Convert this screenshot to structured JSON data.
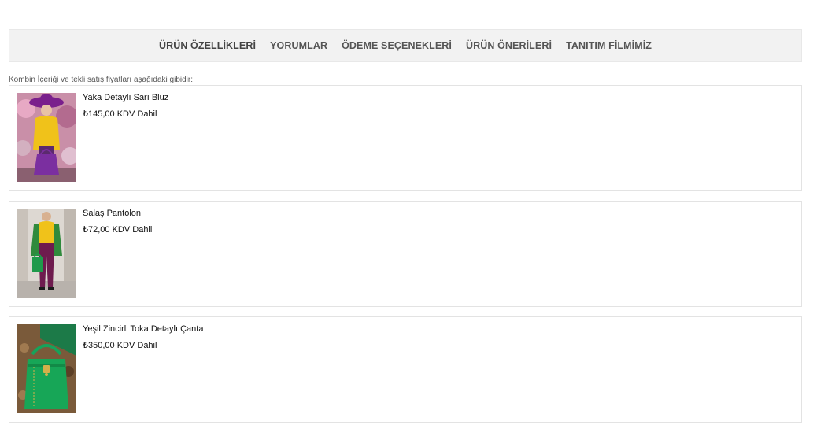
{
  "tabs": [
    {
      "label": "ÜRÜN ÖZELLİKLERİ",
      "active": true
    },
    {
      "label": "YORUMLAR",
      "active": false
    },
    {
      "label": "ÖDEME SEÇENEKLERİ",
      "active": false
    },
    {
      "label": "ÜRÜN ÖNERİLERİ",
      "active": false
    },
    {
      "label": "TANITIM FİLMİMİZ",
      "active": false
    }
  ],
  "intro": "Kombin İçeriği ve tekli satış fiyatları aşağıdaki gibidir:",
  "products": [
    {
      "name": "Yaka Detaylı Sarı Bluz",
      "price": "₺145,00 KDV Dahil",
      "image": "woman-yellow-blouse-purple-hat-photo"
    },
    {
      "name": "Salaş Pantolon",
      "price": "₺72,00 KDV Dahil",
      "image": "woman-purple-trousers-green-coat-photo"
    },
    {
      "name": "Yeşil Zincirli Toka Detaylı Çanta",
      "price": "₺350,00 KDV Dahil",
      "image": "green-handbag-photo"
    }
  ],
  "colors": {
    "tab_bar_bg": "#f2f2f2",
    "active_tab_underline": "#d02424",
    "tab_text": "#555555"
  }
}
